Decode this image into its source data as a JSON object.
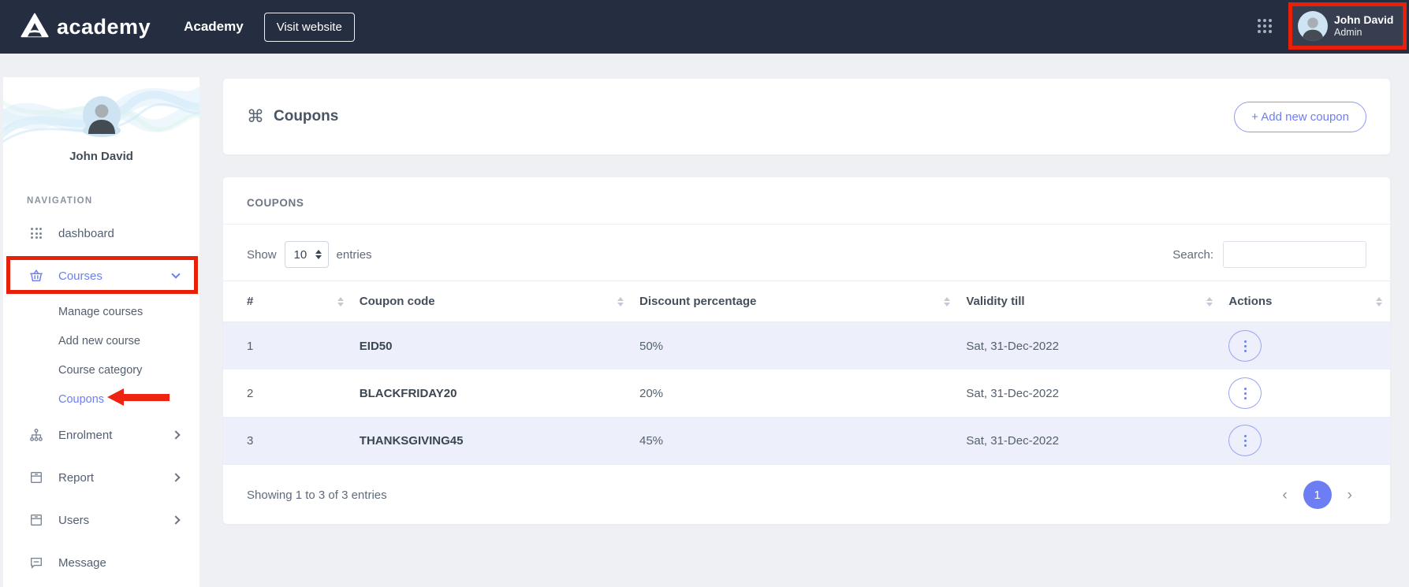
{
  "header": {
    "logo_text": "academy",
    "site_name": "Academy",
    "visit_website_label": "Visit website",
    "user_name": "John David",
    "user_role": "Admin"
  },
  "sidebar": {
    "user_name": "John David",
    "nav_label": "NAVIGATION",
    "items": [
      {
        "label": "dashboard"
      },
      {
        "label": "Courses"
      },
      {
        "label": "Enrolment"
      },
      {
        "label": "Report"
      },
      {
        "label": "Users"
      },
      {
        "label": "Message"
      }
    ],
    "courses_submenu": [
      "Manage courses",
      "Add new course",
      "Course category",
      "Coupons"
    ]
  },
  "page": {
    "title": "Coupons",
    "title_icon": "⌘",
    "add_button_label": "+ Add new coupon"
  },
  "table_card": {
    "title": "COUPONS",
    "show_label": "Show",
    "page_size": "10",
    "entries_label": "entries",
    "search_label": "Search:",
    "search_value": "",
    "columns": [
      "#",
      "Coupon code",
      "Discount percentage",
      "Validity till",
      "Actions"
    ],
    "rows": [
      {
        "num": "1",
        "code": "EID50",
        "discount": "50%",
        "validity": "Sat, 31-Dec-2022"
      },
      {
        "num": "2",
        "code": "BLACKFRIDAY20",
        "discount": "20%",
        "validity": "Sat, 31-Dec-2022"
      },
      {
        "num": "3",
        "code": "THANKSGIVING45",
        "discount": "45%",
        "validity": "Sat, 31-Dec-2022"
      }
    ],
    "footer_text": "Showing 1 to 3 of 3 entries",
    "pagination_prev": "‹",
    "pagination_current": "1",
    "pagination_next": "›"
  },
  "colors": {
    "accent": "#6d7ef5",
    "header_bg": "#252e40",
    "annotation_red": "#e8200a",
    "row_stripe": "#edf0fa"
  }
}
